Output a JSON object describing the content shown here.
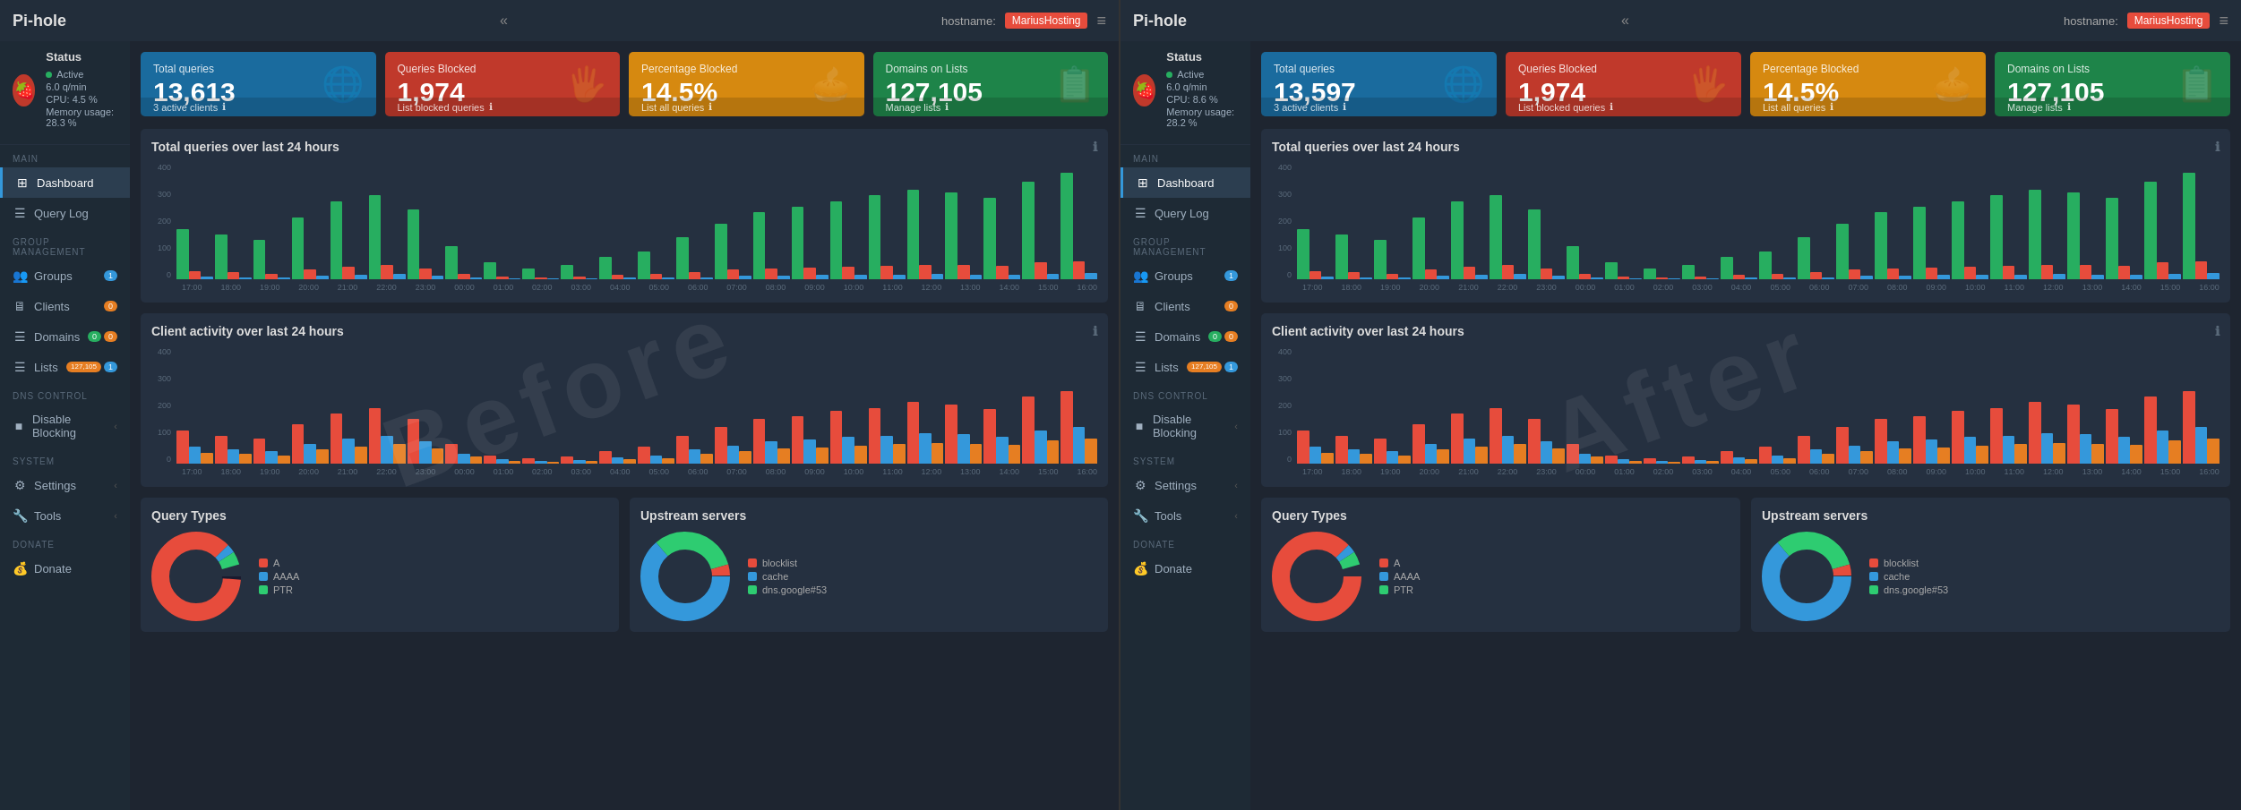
{
  "panels": [
    {
      "id": "before",
      "watermark": "Before",
      "topbar": {
        "logo": "Pi-hole",
        "arrows": "«",
        "hostname_label": "hostname:",
        "hostname_value": "MariusHosting",
        "hamburger": "≡"
      },
      "status": {
        "title": "Status",
        "active_label": "Active",
        "rate": "6.0 q/min",
        "cpu": "CPU: 4.5 %",
        "memory": "Memory usage: 28.3 %"
      },
      "nav": {
        "main_label": "MAIN",
        "items": [
          {
            "label": "Dashboard",
            "icon": "⊞",
            "active": true,
            "name": "dashboard"
          },
          {
            "label": "Query Log",
            "icon": "☰",
            "name": "query-log"
          }
        ],
        "group_label": "GROUP MANAGEMENT",
        "group_items": [
          {
            "label": "Groups",
            "icon": "👥",
            "badge": "1",
            "badge_color": "blue",
            "name": "groups"
          },
          {
            "label": "Clients",
            "icon": "🖥",
            "badge": "0",
            "badge_color": "orange",
            "name": "clients"
          },
          {
            "label": "Domains",
            "icon": "☰",
            "badge1": "0",
            "badge2": "0",
            "name": "domains"
          },
          {
            "label": "Lists",
            "icon": "☰",
            "badge": "127,105",
            "badge_color": "orange",
            "badge2": "1",
            "name": "lists"
          }
        ],
        "dns_label": "DNS CONTROL",
        "dns_items": [
          {
            "label": "Disable Blocking",
            "icon": "■",
            "chevron": "‹",
            "name": "disable-blocking"
          }
        ],
        "system_label": "SYSTEM",
        "system_items": [
          {
            "label": "Settings",
            "icon": "⚙",
            "chevron": "‹",
            "name": "settings"
          },
          {
            "label": "Tools",
            "icon": "✗",
            "chevron": "‹",
            "name": "tools"
          }
        ],
        "donate_label": "DONATE",
        "donate_items": [
          {
            "label": "Donate",
            "icon": "👤",
            "name": "donate"
          }
        ]
      },
      "stat_cards": [
        {
          "label": "Total queries",
          "value": "13,613",
          "icon": "🌐",
          "color": "blue",
          "footer": "3 active clients",
          "footer_icon": "ℹ"
        },
        {
          "label": "Queries Blocked",
          "value": "1,974",
          "icon": "🖐",
          "color": "red",
          "footer": "List blocked queries",
          "footer_icon": "ℹ"
        },
        {
          "label": "Percentage Blocked",
          "value": "14.5%",
          "icon": "🥧",
          "color": "orange",
          "footer": "List all queries",
          "footer_icon": "ℹ"
        },
        {
          "label": "Domains on Lists",
          "value": "127,105",
          "icon": "📋",
          "color": "green",
          "footer": "Manage lists",
          "footer_icon": "ℹ"
        }
      ],
      "chart1": {
        "title": "Total queries over last 24 hours",
        "y_labels": [
          "400",
          "300",
          "200",
          "100",
          "0"
        ],
        "x_labels": [
          "17:00",
          "18:00",
          "19:00",
          "20:00",
          "21:00",
          "22:00",
          "23:00",
          "00:00",
          "01:00",
          "02:00",
          "03:00",
          "04:00",
          "05:00",
          "06:00",
          "07:00",
          "08:00",
          "09:00",
          "10:00",
          "11:00",
          "12:00",
          "13:00",
          "14:00",
          "15:00",
          "16:00"
        ]
      },
      "chart2": {
        "title": "Client activity over last 24 hours",
        "y_labels": [
          "400",
          "300",
          "200",
          "100",
          "0"
        ],
        "x_labels": [
          "17:00",
          "18:00",
          "19:00",
          "20:00",
          "21:00",
          "22:00",
          "23:00",
          "00:00",
          "01:00",
          "02:00",
          "03:00",
          "04:00",
          "05:00",
          "06:00",
          "07:00",
          "08:00",
          "09:00",
          "10:00",
          "11:00",
          "12:00",
          "13:00",
          "14:00",
          "15:00",
          "16:00"
        ]
      },
      "query_types": {
        "title": "Query Types",
        "legend": [
          {
            "label": "A",
            "color": "#e74c3c"
          },
          {
            "label": "AAAA",
            "color": "#3498db"
          },
          {
            "label": "PTR",
            "color": "#2ecc71"
          }
        ]
      },
      "upstream": {
        "title": "Upstream servers",
        "legend": [
          {
            "label": "blocklist",
            "color": "#e74c3c"
          },
          {
            "label": "cache",
            "color": "#3498db"
          },
          {
            "label": "dns.google#53",
            "color": "#2ecc71"
          }
        ]
      }
    },
    {
      "id": "after",
      "watermark": "After",
      "topbar": {
        "logo": "Pi-hole",
        "arrows": "«",
        "hostname_label": "hostname:",
        "hostname_value": "MariusHosting",
        "hamburger": "≡"
      },
      "status": {
        "title": "Status",
        "active_label": "Active",
        "rate": "6.0 q/min",
        "cpu": "CPU: 8.6 %",
        "memory": "Memory usage: 28.2 %"
      },
      "nav": {
        "main_label": "MAIN",
        "items": [
          {
            "label": "Dashboard",
            "icon": "⊞",
            "active": true,
            "name": "dashboard"
          },
          {
            "label": "Query Log",
            "icon": "☰",
            "name": "query-log"
          }
        ],
        "group_label": "GROUP MANAGEMENT",
        "group_items": [
          {
            "label": "Groups",
            "icon": "👥",
            "badge": "1",
            "badge_color": "blue",
            "name": "groups"
          },
          {
            "label": "Clients",
            "icon": "🖥",
            "badge": "0",
            "badge_color": "orange",
            "name": "clients"
          },
          {
            "label": "Domains",
            "icon": "☰",
            "badge1": "0",
            "badge2": "0",
            "name": "domains"
          },
          {
            "label": "Lists",
            "icon": "☰",
            "badge": "127,105",
            "badge_color": "orange",
            "badge2": "1",
            "name": "lists"
          }
        ],
        "dns_label": "DNS CONTROL",
        "dns_items": [
          {
            "label": "Disable Blocking",
            "icon": "■",
            "chevron": "‹",
            "name": "disable-blocking"
          }
        ],
        "system_label": "SYSTEM",
        "system_items": [
          {
            "label": "Settings",
            "icon": "⚙",
            "chevron": "‹",
            "name": "settings"
          },
          {
            "label": "Tools",
            "icon": "✗",
            "chevron": "‹",
            "name": "tools"
          }
        ],
        "donate_label": "DONATE",
        "donate_items": [
          {
            "label": "Donate",
            "icon": "👤",
            "name": "donate"
          }
        ]
      },
      "stat_cards": [
        {
          "label": "Total queries",
          "value": "13,597",
          "icon": "🌐",
          "color": "blue",
          "footer": "3 active clients",
          "footer_icon": "ℹ"
        },
        {
          "label": "Queries Blocked",
          "value": "1,974",
          "icon": "🖐",
          "color": "red",
          "footer": "List blocked queries",
          "footer_icon": "ℹ"
        },
        {
          "label": "Percentage Blocked",
          "value": "14.5%",
          "icon": "🥧",
          "color": "orange",
          "footer": "List all queries",
          "footer_icon": "ℹ"
        },
        {
          "label": "Domains on Lists",
          "value": "127,105",
          "icon": "📋",
          "color": "green",
          "footer": "Manage lists",
          "footer_icon": "ℹ"
        }
      ],
      "chart1": {
        "title": "Total queries over last 24 hours",
        "y_labels": [
          "400",
          "300",
          "200",
          "100",
          "0"
        ],
        "x_labels": [
          "17:00",
          "18:00",
          "19:00",
          "20:00",
          "21:00",
          "22:00",
          "23:00",
          "00:00",
          "01:00",
          "02:00",
          "03:00",
          "04:00",
          "05:00",
          "06:00",
          "07:00",
          "08:00",
          "09:00",
          "10:00",
          "11:00",
          "12:00",
          "13:00",
          "14:00",
          "15:00",
          "16:00"
        ]
      },
      "chart2": {
        "title": "Client activity over last 24 hours",
        "y_labels": [
          "400",
          "300",
          "200",
          "100",
          "0"
        ],
        "x_labels": [
          "17:00",
          "18:00",
          "19:00",
          "20:00",
          "21:00",
          "22:00",
          "23:00",
          "00:00",
          "01:00",
          "02:00",
          "03:00",
          "04:00",
          "05:00",
          "06:00",
          "07:00",
          "08:00",
          "09:00",
          "10:00",
          "11:00",
          "12:00",
          "13:00",
          "14:00",
          "15:00",
          "16:00"
        ]
      },
      "query_types": {
        "title": "Query Types",
        "legend": [
          {
            "label": "A",
            "color": "#e74c3c"
          },
          {
            "label": "AAAA",
            "color": "#3498db"
          },
          {
            "label": "PTR",
            "color": "#2ecc71"
          }
        ]
      },
      "upstream": {
        "title": "Upstream servers",
        "legend": [
          {
            "label": "blocklist",
            "color": "#e74c3c"
          },
          {
            "label": "cache",
            "color": "#3498db"
          },
          {
            "label": "dns.google#53",
            "color": "#2ecc71"
          }
        ]
      }
    }
  ]
}
